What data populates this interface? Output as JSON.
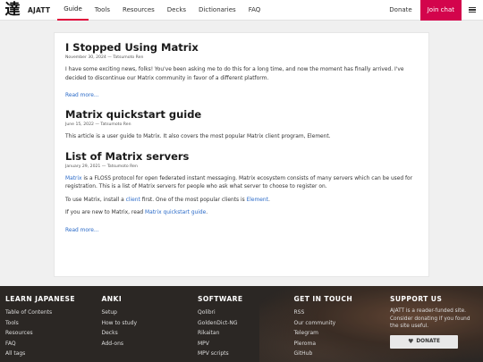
{
  "nav": {
    "logo_glyph": "達",
    "logo_text": "AJATT",
    "links": [
      "Guide",
      "Tools",
      "Resources",
      "Decks",
      "Dictionaries",
      "FAQ"
    ],
    "active_link": "Guide",
    "donate": "Donate",
    "join_chat": "Join chat",
    "accent_color": "#d3044c"
  },
  "posts": [
    {
      "title": "I Stopped Using Matrix",
      "meta": "November 30, 2024 — Tatsumoto Ren",
      "body": "I have some exciting news, folks! You've been asking me to do this for a long time, and now the moment has finally arrived. I've decided to discontinue our Matrix community in favor of a different platform.",
      "read_more": "Read more..."
    },
    {
      "title": "Matrix quickstart guide",
      "meta": "June 15, 2022 — Tatsumoto Ren",
      "body": "This article is a user guide to Matrix. It also covers the most popular Matrix client program, Element.",
      "read_more": ""
    },
    {
      "title": "List of Matrix servers",
      "meta": "January 29, 2021 — Tatsumoto Ren",
      "p1_link": "Matrix",
      "p1_rest": " is a FLOSS protocol for open federated instant messaging. Matrix ecosystem consists of many servers which can be used for registration. This is a list of Matrix servers for people who ask what server to choose to register on.",
      "p2_a": "To use Matrix, install a ",
      "p2_link1": "client",
      "p2_b": " first. One of the most popular clients is ",
      "p2_link2": "Element",
      "p2_c": ".",
      "p3_a": "If you are new to Matrix, read ",
      "p3_link": "Matrix quickstart guide",
      "p3_b": ".",
      "read_more": "Read more..."
    }
  ],
  "footer": {
    "learn": {
      "heading": "LEARN JAPANESE",
      "items": [
        "Table of Contents",
        "Tools",
        "Resources",
        "FAQ",
        "All tags"
      ]
    },
    "anki": {
      "heading": "ANKI",
      "items": [
        "Setup",
        "How to study",
        "Decks",
        "Add-ons"
      ]
    },
    "software": {
      "heading": "SOFTWARE",
      "items": [
        "Qolibri",
        "GoldenDict-NG",
        "Rikaitan",
        "MPV",
        "MPV scripts"
      ]
    },
    "contact": {
      "heading": "GET IN TOUCH",
      "items": [
        "RSS",
        "Our community",
        "Telegram",
        "Pleroma",
        "GitHub"
      ]
    },
    "support": {
      "heading": "SUPPORT US",
      "text": "AJATT is a reader-funded site. Consider donating if you found the site useful.",
      "button": "DONATE"
    }
  }
}
